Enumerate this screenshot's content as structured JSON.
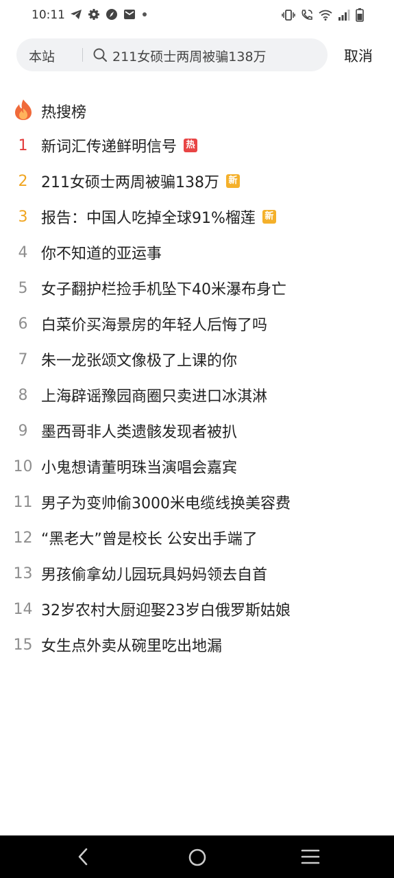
{
  "status_bar": {
    "time": "10:11",
    "left_icons": [
      "telegram-icon",
      "gear-icon",
      "compass-icon",
      "mail-icon",
      "dot-icon"
    ],
    "right_icons": [
      "vibrate-icon",
      "wifi-call-icon",
      "wifi-icon",
      "signal-icon",
      "battery-icon"
    ]
  },
  "search": {
    "scope_label": "本站",
    "query": "211女硕士两周被骗138万",
    "cancel_label": "取消"
  },
  "hot_list": {
    "header_title": "热搜榜",
    "items": [
      {
        "rank": "1",
        "title": "新词汇传递鲜明信号",
        "badge": "热"
      },
      {
        "rank": "2",
        "title": "211女硕士两周被骗138万",
        "badge": "新"
      },
      {
        "rank": "3",
        "title": "报告：中国人吃掉全球91%榴莲",
        "badge": "新"
      },
      {
        "rank": "4",
        "title": "你不知道的亚运事",
        "badge": ""
      },
      {
        "rank": "5",
        "title": "女子翻护栏捡手机坠下40米瀑布身亡",
        "badge": ""
      },
      {
        "rank": "6",
        "title": "白菜价买海景房的年轻人后悔了吗",
        "badge": ""
      },
      {
        "rank": "7",
        "title": "朱一龙张颂文像极了上课的你",
        "badge": ""
      },
      {
        "rank": "8",
        "title": "上海辟谣豫园商圈只卖进口冰淇淋",
        "badge": ""
      },
      {
        "rank": "9",
        "title": "墨西哥非人类遗骸发现者被扒",
        "badge": ""
      },
      {
        "rank": "10",
        "title": "小鬼想请董明珠当演唱会嘉宾",
        "badge": ""
      },
      {
        "rank": "11",
        "title": "男子为变帅偷3000米电缆线换美容费",
        "badge": ""
      },
      {
        "rank": "12",
        "title": "“黑老大”曾是校长 公安出手端了",
        "badge": ""
      },
      {
        "rank": "13",
        "title": "男孩偷拿幼儿园玩具妈妈领去自首",
        "badge": ""
      },
      {
        "rank": "14",
        "title": "32岁农村大厨迎娶23岁白俄罗斯姑娘",
        "badge": ""
      },
      {
        "rank": "15",
        "title": "女生点外卖从碗里吃出地漏",
        "badge": ""
      }
    ]
  },
  "colors": {
    "rank1": "#e23a3a",
    "rank2_3": "#f0a520",
    "hot_badge": "#e84545",
    "new_badge": "#f4b02a"
  },
  "nav_bar": {
    "buttons": [
      "back-icon",
      "home-icon",
      "recents-icon"
    ]
  }
}
